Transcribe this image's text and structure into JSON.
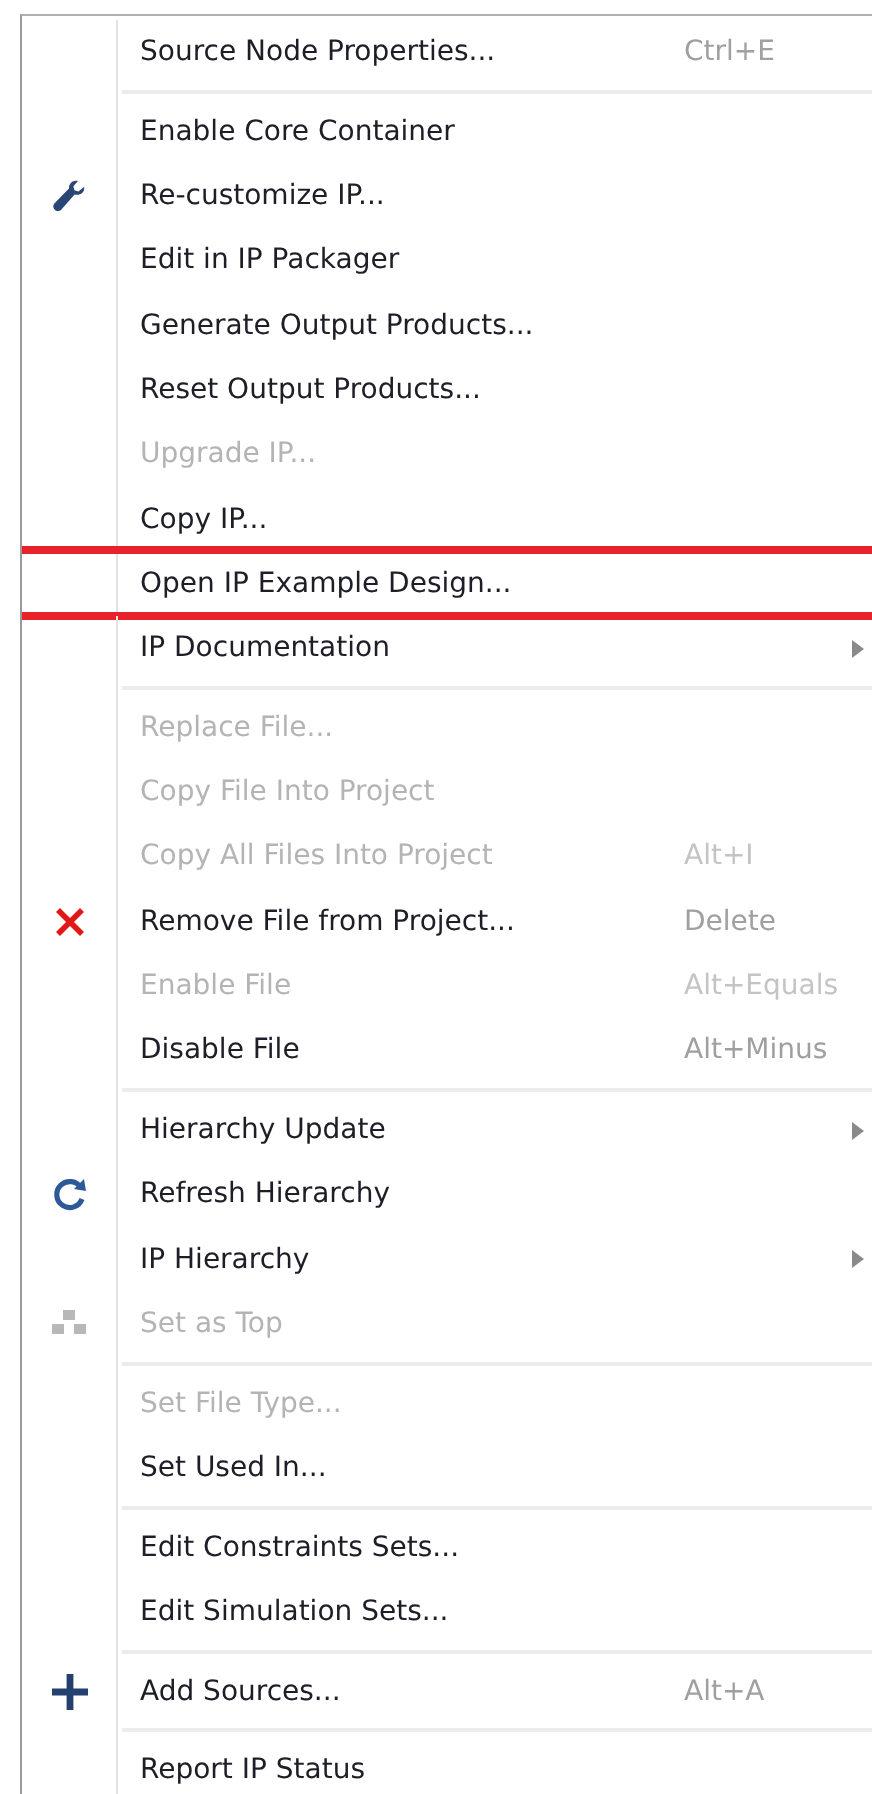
{
  "menu": {
    "groups": [
      {
        "items": [
          {
            "label": "Source Node Properties...",
            "shortcut": "Ctrl+E",
            "disabled": false
          }
        ]
      },
      {
        "items": [
          {
            "label": "Enable Core Container",
            "disabled": false
          },
          {
            "label": "Re-customize IP...",
            "disabled": false,
            "kind": "wrench"
          },
          {
            "label": "Edit in IP Packager",
            "disabled": false
          },
          {
            "label": "Generate Output Products...",
            "disabled": false
          },
          {
            "label": "Reset Output Products...",
            "disabled": false
          },
          {
            "label": "Upgrade IP...",
            "disabled": true
          },
          {
            "label": "Copy IP...",
            "disabled": false
          },
          {
            "label": "Open IP Example Design...",
            "disabled": false,
            "outlined": true
          },
          {
            "label": "IP Documentation",
            "disabled": false,
            "submenu": true
          }
        ]
      },
      {
        "items": [
          {
            "label": "Replace File...",
            "disabled": true
          },
          {
            "label": "Copy File Into Project",
            "disabled": true
          },
          {
            "label": "Copy All Files Into Project",
            "shortcut": "Alt+I",
            "disabled": true
          },
          {
            "label": "Remove File from Project...",
            "shortcut": "Delete",
            "disabled": false,
            "kind": "cross"
          },
          {
            "label": "Enable File",
            "shortcut": "Alt+Equals",
            "disabled": true
          },
          {
            "label": "Disable File",
            "shortcut": "Alt+Minus",
            "disabled": false
          }
        ]
      },
      {
        "items": [
          {
            "label": "Hierarchy Update",
            "disabled": false,
            "submenu": true
          },
          {
            "label": "Refresh Hierarchy",
            "disabled": false,
            "kind": "refresh"
          },
          {
            "label": "IP Hierarchy",
            "disabled": false,
            "submenu": true
          },
          {
            "label": "Set as Top",
            "disabled": true,
            "kind": "blocks"
          }
        ]
      },
      {
        "items": [
          {
            "label": "Set File Type...",
            "disabled": true
          },
          {
            "label": "Set Used In...",
            "disabled": false
          }
        ]
      },
      {
        "items": [
          {
            "label": "Edit Constraints Sets...",
            "disabled": false
          },
          {
            "label": "Edit Simulation Sets...",
            "disabled": false
          }
        ]
      },
      {
        "items": [
          {
            "label": "Add Sources...",
            "shortcut": "Alt+A",
            "disabled": false,
            "kind": "plus"
          }
        ]
      },
      {
        "items": [
          {
            "label": "Report IP Status",
            "disabled": false
          }
        ]
      }
    ]
  }
}
